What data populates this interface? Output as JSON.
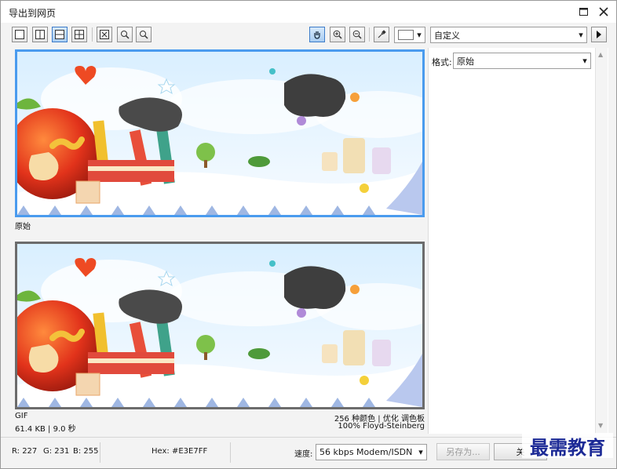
{
  "window": {
    "title": "导出到网页"
  },
  "toolbar": {
    "view_buttons": [
      {
        "name": "full-preview",
        "icon": "single-view-icon"
      },
      {
        "name": "split-vertical",
        "icon": "split-vertical-icon"
      },
      {
        "name": "split-horizontal",
        "icon": "split-horizontal-icon"
      },
      {
        "name": "quad",
        "icon": "quad-view-icon"
      }
    ],
    "zoom_buttons": [
      {
        "name": "fit",
        "icon": "fit-to-window-icon"
      },
      {
        "name": "zoom-actual",
        "icon": "zoom-actual-icon"
      },
      {
        "name": "zoom-100",
        "icon": "zoom-100-icon"
      }
    ],
    "preset_value": "自定义"
  },
  "preview": {
    "top_label": "原始",
    "bottom": {
      "format": "GIF",
      "size_time": "61.4 KB  |  9.0 秒",
      "colors_optimize": "256 种颜色  |  优化 调色板",
      "dither": "100% Floyd-Steinberg"
    }
  },
  "settings": {
    "format_label": "格式:",
    "format_value": "原始"
  },
  "status": {
    "r": "R: 227",
    "g": "G: 231",
    "b": "B: 255",
    "hex": "Hex: #E3E7FF",
    "speed_label": "速度:",
    "speed_value": "56 kbps Modem/ISDN"
  },
  "buttons": {
    "save_as": "另存为...",
    "close": "关"
  },
  "watermark": "最需教育",
  "colors": {
    "accent": "#4a9bee",
    "frame_bottom": "#6c6c6c",
    "watermark": "#1c2a96"
  }
}
